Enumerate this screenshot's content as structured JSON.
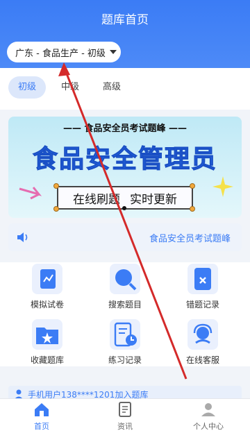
{
  "header": {
    "title": "题库首页",
    "region": "广东 - 食品生产 - 初级"
  },
  "levels": [
    {
      "label": "初级",
      "active": true
    },
    {
      "label": "中级",
      "active": false
    },
    {
      "label": "高级",
      "active": false
    }
  ],
  "banner": {
    "subtitle": "—— 食品安全员考试题峰 ——",
    "title": "食品安全管理员",
    "slogan_left": "在线刷题",
    "slogan_right": "实时更新"
  },
  "notice": {
    "text": "食品安全员考试题峰"
  },
  "grid": [
    {
      "label": "模拟试卷",
      "icon": "exam-icon"
    },
    {
      "label": "搜索题目",
      "icon": "search-icon"
    },
    {
      "label": "错题记录",
      "icon": "wrong-record-icon"
    },
    {
      "label": "收藏题库",
      "icon": "favorite-icon"
    },
    {
      "label": "练习记录",
      "icon": "practice-icon"
    },
    {
      "label": "在线客服",
      "icon": "service-icon"
    }
  ],
  "user_notice": "手机用户138****1201加入题库",
  "tabs": [
    {
      "label": "首页",
      "icon": "home-icon",
      "active": true
    },
    {
      "label": "资讯",
      "icon": "news-icon",
      "active": false
    },
    {
      "label": "个人中心",
      "icon": "profile-icon",
      "active": false
    }
  ],
  "colors": {
    "primary": "#3b7cf5",
    "background": "#f1f4f9"
  }
}
